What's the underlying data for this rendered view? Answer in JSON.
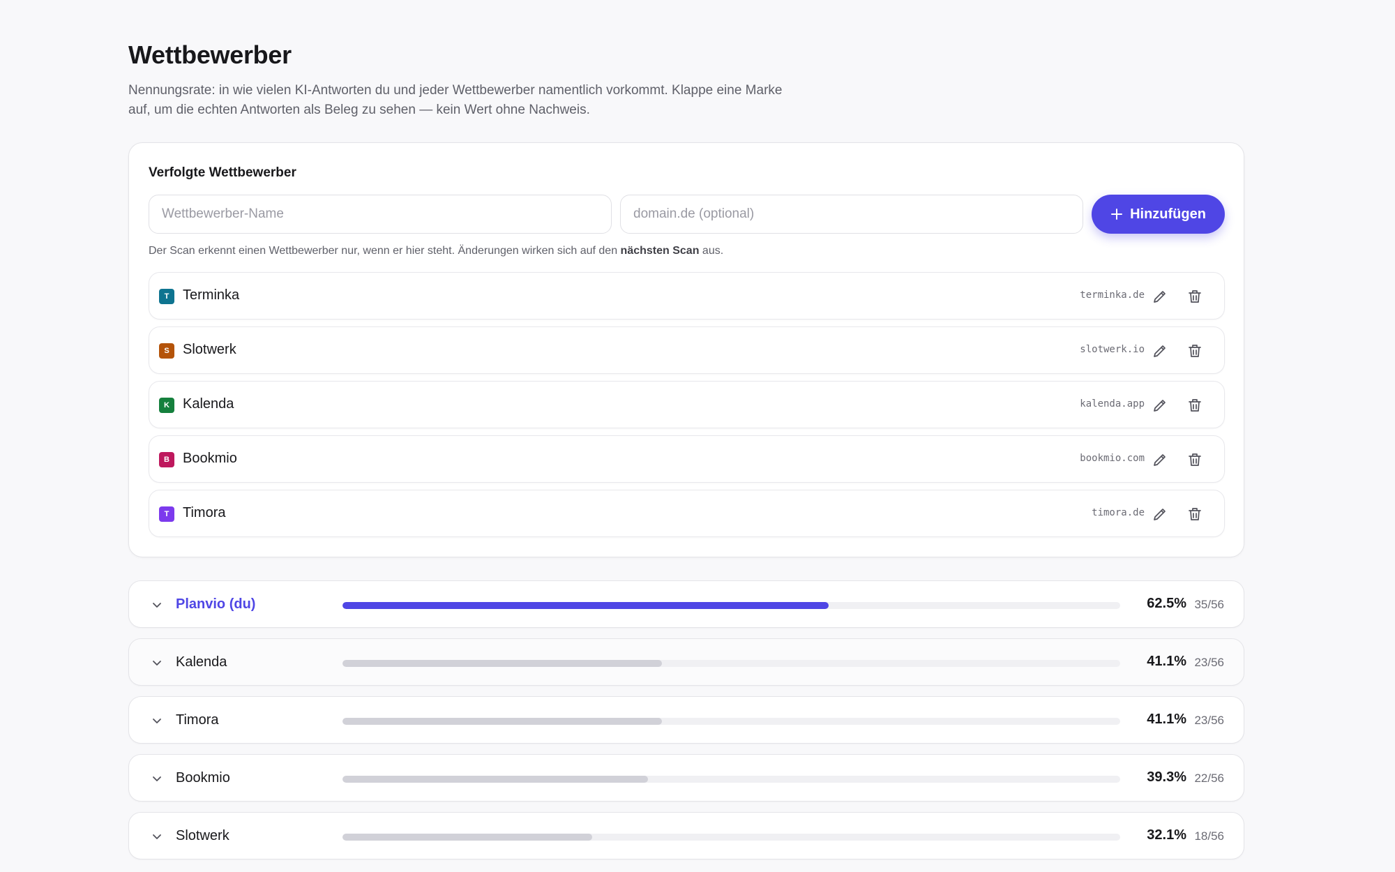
{
  "page": {
    "title": "Wettbewerber",
    "subtitle": "Nennungsrate: in wie vielen KI-Antworten du und jeder Wettbewerber namentlich vorkommt. Klappe eine Marke auf, um die echten Antworten als Beleg zu sehen — kein Wert ohne Nachweis."
  },
  "tracked": {
    "title": "Verfolgte Wettbewerber",
    "name_placeholder": "Wettbewerber-Name",
    "domain_placeholder": "domain.de (optional)",
    "add_label": "Hinzufügen",
    "hint_before": "Der Scan erkennt einen Wettbewerber nur, wenn er hier steht. Änderungen wirken sich auf den ",
    "hint_bold": "nächsten Scan",
    "hint_after": " aus.",
    "items": [
      {
        "initial": "T",
        "name": "Terminka",
        "domain": "terminka.de",
        "color": "#0e7490"
      },
      {
        "initial": "S",
        "name": "Slotwerk",
        "domain": "slotwerk.io",
        "color": "#b45309"
      },
      {
        "initial": "K",
        "name": "Kalenda",
        "domain": "kalenda.app",
        "color": "#15803d"
      },
      {
        "initial": "B",
        "name": "Bookmio",
        "domain": "bookmio.com",
        "color": "#be185d"
      },
      {
        "initial": "T",
        "name": "Timora",
        "domain": "timora.de",
        "color": "#7c3aed"
      }
    ]
  },
  "ranking": [
    {
      "name": "Planvio (du)",
      "pct": "62.5%",
      "count": "35/56",
      "rate": 0.625,
      "self": true
    },
    {
      "name": "Kalenda",
      "pct": "41.1%",
      "count": "23/56",
      "rate": 0.411
    },
    {
      "name": "Timora",
      "pct": "41.1%",
      "count": "23/56",
      "rate": 0.411
    },
    {
      "name": "Bookmio",
      "pct": "39.3%",
      "count": "22/56",
      "rate": 0.393
    },
    {
      "name": "Slotwerk",
      "pct": "32.1%",
      "count": "18/56",
      "rate": 0.321
    }
  ],
  "colors": {
    "accent": "#4f46e5",
    "bar_muted": "#d1d1d8"
  }
}
